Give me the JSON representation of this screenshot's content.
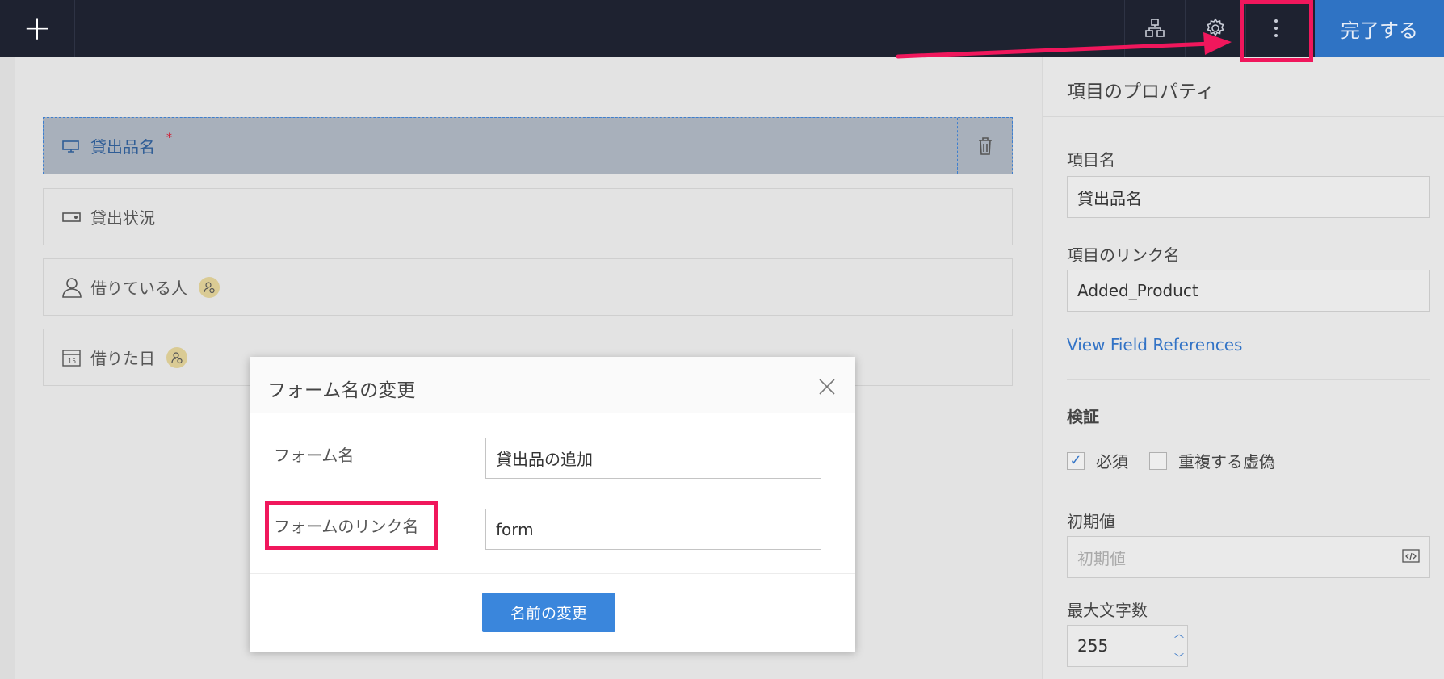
{
  "topbar": {
    "add_label": "+",
    "done_label": "完了する",
    "icons": [
      "hierarchy-icon",
      "gear-icon",
      "more-vertical-icon"
    ]
  },
  "fields": [
    {
      "label": "貸出品名",
      "icon": "single-line-icon",
      "required_mark": "*",
      "selected": true
    },
    {
      "label": "貸出状況",
      "icon": "dropdown-icon"
    },
    {
      "label": "借りている人",
      "icon": "user-icon",
      "badge": "personal-data-icon"
    },
    {
      "label": "借りた日",
      "icon": "calendar-icon",
      "badge": "personal-data-icon"
    }
  ],
  "props": {
    "title": "項目のプロパティ",
    "field_name_label": "項目名",
    "field_name_value": "貸出品名",
    "link_name_label": "項目のリンク名",
    "link_name_value": "Added_Product",
    "references_link": "View Field References",
    "validation_title": "検証",
    "required_label": "必須",
    "required_checked": true,
    "no_duplicate_label": "重複する虚偽",
    "no_duplicate_checked": false,
    "initial_label": "初期値",
    "initial_placeholder": "初期値",
    "max_chars_label": "最大文字数",
    "max_chars_value": "255"
  },
  "modal": {
    "title": "フォーム名の変更",
    "form_name_label": "フォーム名",
    "form_name_value": "貸出品の追加",
    "link_name_label": "フォームのリンク名",
    "link_name_value": "form",
    "submit_label": "名前の変更"
  },
  "annotation_color": "#f0175c"
}
